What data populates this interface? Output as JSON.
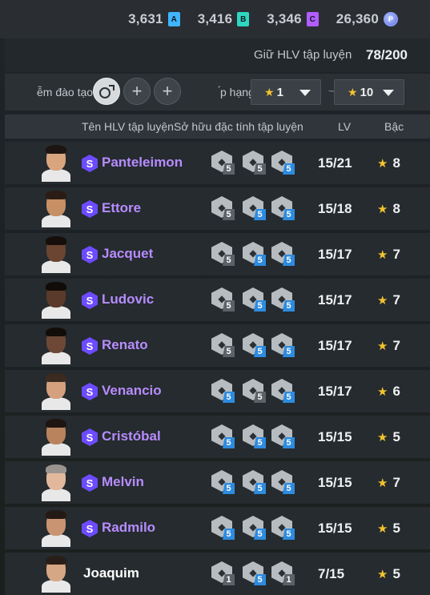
{
  "currencies": [
    {
      "value": "3,631",
      "badge": "A",
      "color": "#3fb6ff"
    },
    {
      "value": "3,416",
      "badge": "B",
      "color": "#2fd6c0"
    },
    {
      "value": "3,346",
      "badge": "C",
      "color": "#b35cff"
    },
    {
      "value": "26,360",
      "badge": "coin",
      "color": "#6b7ff0"
    }
  ],
  "keep": {
    "label": "Giữ HLV tập luyện",
    "count": "78/200"
  },
  "filter": {
    "label": "ễm đào tạo",
    "rank_label": "́p hạng",
    "min_rank": "1",
    "max_rank": "10",
    "tilde": "~"
  },
  "columns": {
    "name": "Tên HLV tập luyện",
    "traits": "Sở hữu đặc tính tập luyện",
    "lv": "LV",
    "grade": "Bậc"
  },
  "coaches": [
    {
      "name": "Panteleimon",
      "special": true,
      "lv": "15/21",
      "grade": "8",
      "skin": "#d9a57f",
      "hair": "#1d1512",
      "traits": [
        {
          "icon": "whistle-icon",
          "level": "5",
          "tier": "grey"
        },
        {
          "icon": "tactics-icon",
          "level": "5",
          "tier": "grey"
        },
        {
          "icon": "ball-icon",
          "level": "5",
          "tier": "blue"
        }
      ]
    },
    {
      "name": "Ettore",
      "special": true,
      "lv": "15/18",
      "grade": "8",
      "skin": "#c68f64",
      "hair": "#2b1d15",
      "traits": [
        {
          "icon": "tactics-icon",
          "level": "5",
          "tier": "grey"
        },
        {
          "icon": "board-icon",
          "level": "5",
          "tier": "blue"
        },
        {
          "icon": "ball-icon",
          "level": "5",
          "tier": "blue"
        }
      ]
    },
    {
      "name": "Jacquet",
      "special": true,
      "lv": "15/17",
      "grade": "7",
      "skin": "#6b4531",
      "hair": "#150e0b",
      "traits": [
        {
          "icon": "trophy-icon",
          "level": "5",
          "tier": "grey"
        },
        {
          "icon": "board-icon",
          "level": "5",
          "tier": "blue"
        },
        {
          "icon": "ball-icon",
          "level": "5",
          "tier": "blue"
        }
      ]
    },
    {
      "name": "Ludovic",
      "special": true,
      "lv": "15/17",
      "grade": "7",
      "skin": "#5a3a2a",
      "hair": "#120c09",
      "traits": [
        {
          "icon": "goal-icon",
          "level": "5",
          "tier": "grey"
        },
        {
          "icon": "ball-icon",
          "level": "5",
          "tier": "blue"
        },
        {
          "icon": "runner-icon",
          "level": "5",
          "tier": "blue"
        }
      ]
    },
    {
      "name": "Renato",
      "special": true,
      "lv": "15/17",
      "grade": "7",
      "skin": "#6e4836",
      "hair": "#130d0a",
      "traits": [
        {
          "icon": "trophy-icon",
          "level": "5",
          "tier": "grey"
        },
        {
          "icon": "board-icon",
          "level": "5",
          "tier": "blue"
        },
        {
          "icon": "ball-icon",
          "level": "5",
          "tier": "blue"
        }
      ]
    },
    {
      "name": "Venancio",
      "special": true,
      "lv": "15/17",
      "grade": "6",
      "skin": "#d4a07e",
      "hair": "#3a2a20",
      "traits": [
        {
          "icon": "kick-icon",
          "level": "5",
          "tier": "blue"
        },
        {
          "icon": "tackle-icon",
          "level": "5",
          "tier": "grey"
        },
        {
          "icon": "ball-icon",
          "level": "5",
          "tier": "blue"
        }
      ]
    },
    {
      "name": "Cristóbal",
      "special": true,
      "lv": "15/15",
      "grade": "5",
      "skin": "#b9835e",
      "hair": "#1e1511",
      "traits": [
        {
          "icon": "ball-icon",
          "level": "5",
          "tier": "blue"
        },
        {
          "icon": "board-icon",
          "level": "5",
          "tier": "blue"
        },
        {
          "icon": "ball-icon",
          "level": "5",
          "tier": "blue"
        }
      ]
    },
    {
      "name": "Melvin",
      "special": true,
      "lv": "15/15",
      "grade": "7",
      "skin": "#e2b89c",
      "hair": "#9a9490",
      "traits": [
        {
          "icon": "board-icon",
          "level": "5",
          "tier": "blue"
        },
        {
          "icon": "ball-icon",
          "level": "5",
          "tier": "blue"
        },
        {
          "icon": "runner-icon",
          "level": "5",
          "tier": "blue"
        }
      ]
    },
    {
      "name": "Radmilo",
      "special": true,
      "lv": "15/15",
      "grade": "5",
      "skin": "#c99472",
      "hair": "#241a15",
      "traits": [
        {
          "icon": "tactics-icon",
          "level": "5",
          "tier": "blue"
        },
        {
          "icon": "ball-icon",
          "level": "5",
          "tier": "blue"
        },
        {
          "icon": "cone-icon",
          "level": "5",
          "tier": "blue"
        }
      ]
    },
    {
      "name": "Joaquim",
      "special": false,
      "lv": "7/15",
      "grade": "5",
      "skin": "#d6a784",
      "hair": "#2a1f18",
      "traits": [
        {
          "icon": "ball-icon",
          "level": "1",
          "tier": "grey"
        },
        {
          "icon": "ball-icon",
          "level": "5",
          "tier": "blue"
        },
        {
          "icon": "target-icon",
          "level": "1",
          "tier": "grey"
        }
      ]
    }
  ]
}
